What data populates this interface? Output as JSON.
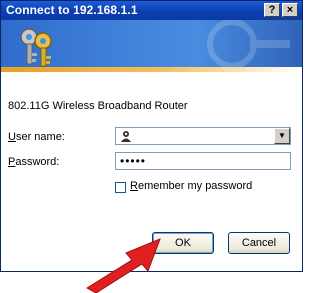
{
  "window": {
    "title": "Connect to 192.168.1.1",
    "help_button": "?",
    "close_button": "×"
  },
  "dialog": {
    "router_name": "802.11G Wireless Broadband Router",
    "username_label": "User name:",
    "password_label": "Password:",
    "password_mask": "•••••",
    "remember_label": "Remember my password",
    "ok_label": "OK",
    "cancel_label": "Cancel"
  },
  "annotation": {
    "arrow_color": "#e02020"
  }
}
